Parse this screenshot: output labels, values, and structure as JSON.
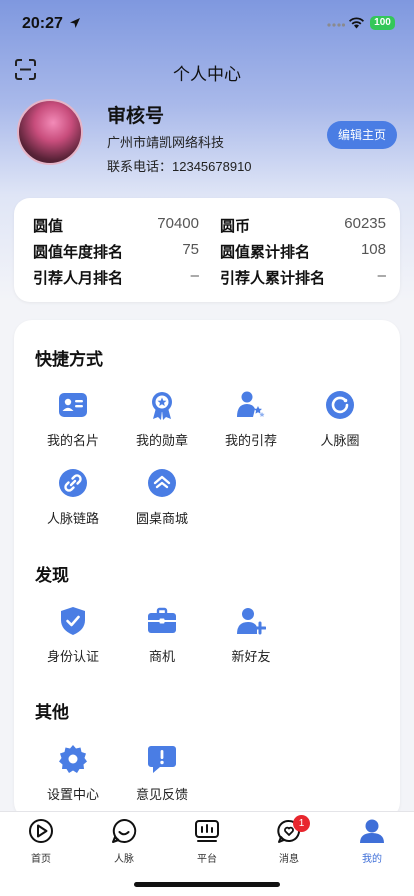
{
  "status_bar": {
    "time": "20:27",
    "battery": "100"
  },
  "nav": {
    "title": "个人中心"
  },
  "profile": {
    "name": "审核号",
    "company": "广州市靖凯网络科技",
    "phone": "联系电话：12345678910",
    "edit_label": "编辑主页"
  },
  "stats": [
    {
      "label": "圆值",
      "value": "70400"
    },
    {
      "label": "圆币",
      "value": "60235"
    },
    {
      "label": "圆值年度排名",
      "value": "75"
    },
    {
      "label": "圆值累计排名",
      "value": "108"
    },
    {
      "label": "引荐人月排名",
      "value": "–"
    },
    {
      "label": "引荐人累计排名",
      "value": "–"
    }
  ],
  "sections": {
    "shortcuts": {
      "title": "快捷方式",
      "items": [
        {
          "label": "我的名片",
          "icon": "business-card-icon"
        },
        {
          "label": "我的勋章",
          "icon": "medal-icon"
        },
        {
          "label": "我的引荐",
          "icon": "referral-icon"
        },
        {
          "label": "人脉圈",
          "icon": "circle-icon"
        },
        {
          "label": "人脉链路",
          "icon": "link-icon"
        },
        {
          "label": "圆桌商城",
          "icon": "mall-icon"
        }
      ]
    },
    "discover": {
      "title": "发现",
      "items": [
        {
          "label": "身份认证",
          "icon": "shield-check-icon"
        },
        {
          "label": "商机",
          "icon": "briefcase-icon"
        },
        {
          "label": "新好友",
          "icon": "add-friend-icon"
        }
      ]
    },
    "other": {
      "title": "其他",
      "items": [
        {
          "label": "设置中心",
          "icon": "gear-icon"
        },
        {
          "label": "意见反馈",
          "icon": "feedback-icon"
        }
      ]
    }
  },
  "tabbar": {
    "items": [
      {
        "label": "首页",
        "icon": "home-icon"
      },
      {
        "label": "人脉",
        "icon": "contacts-icon"
      },
      {
        "label": "平台",
        "icon": "platform-icon"
      },
      {
        "label": "消息",
        "icon": "message-icon"
      },
      {
        "label": "我的",
        "icon": "profile-icon"
      }
    ],
    "active": "我的",
    "message_badge": "1"
  },
  "colors": {
    "accent": "#4a7de4",
    "badge": "#e8262e",
    "icon_blue": "#4a7de4"
  }
}
